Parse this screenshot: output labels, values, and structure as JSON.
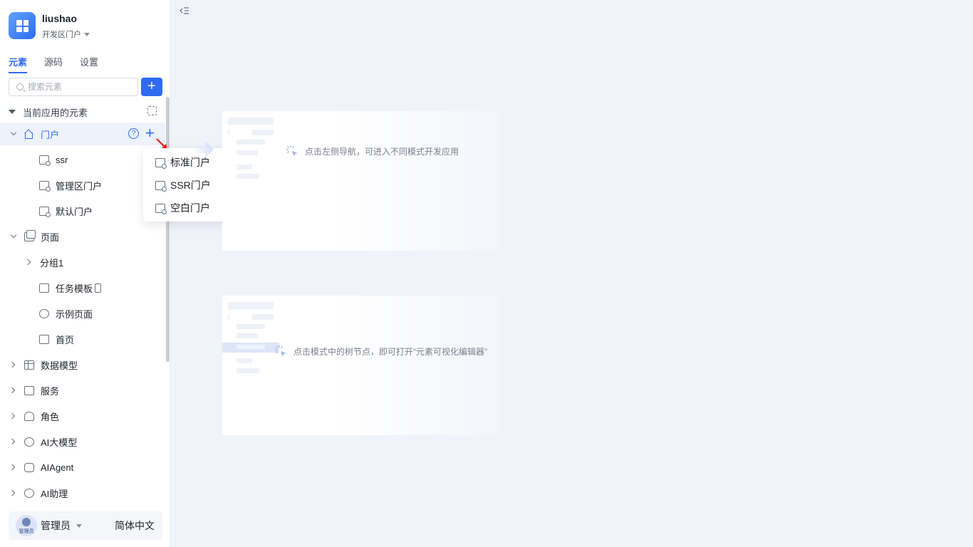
{
  "app": {
    "name": "liushao",
    "subtitle": "开发区门户"
  },
  "tabs": [
    {
      "label": "元素",
      "active": true
    },
    {
      "label": "源码",
      "active": false
    },
    {
      "label": "设置",
      "active": false
    }
  ],
  "search": {
    "placeholder": "搜索元素"
  },
  "add_button": {
    "label": "+"
  },
  "tree": {
    "header": "当前应用的元素",
    "portal": {
      "label": "门户",
      "help": "?",
      "add": "+"
    },
    "portal_children": [
      "ssr",
      "管理区门户",
      "默认门户"
    ],
    "pages": {
      "label": "页面"
    },
    "pages_children": [
      "分组1",
      "任务模板",
      "示例页面",
      "首页"
    ],
    "sections": [
      "数据模型",
      "服务",
      "角色",
      "AI大模型",
      "AIAgent",
      "AI助理"
    ]
  },
  "dropdown": {
    "items": [
      "标准门户",
      "SSR门户",
      "空白门户"
    ]
  },
  "user": {
    "name": "管理员",
    "avatar_tag": "管理员",
    "language": "简体中文"
  },
  "hints": {
    "left_nav": "点击左侧导航，可进入不同模式开发应用",
    "tree_node": "点击模式中的树节点，即可打开“元素可视化编辑器”"
  },
  "colors": {
    "accent": "#2f6bf0",
    "canvas_bg": "#f1f3fa",
    "arrow": "#e8201a"
  }
}
